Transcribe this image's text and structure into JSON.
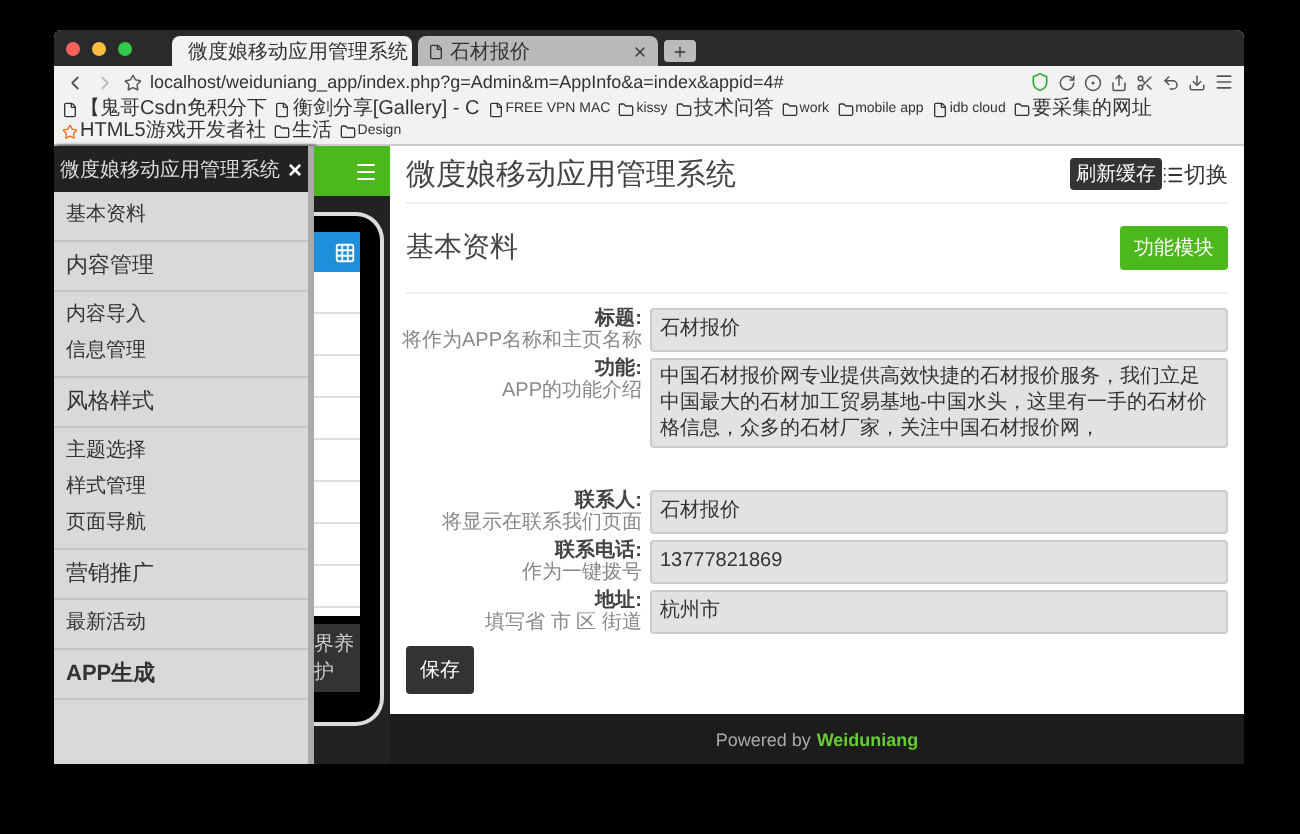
{
  "browser": {
    "tabs": [
      {
        "title": "微度娘移动应用管理系统",
        "selected": true
      },
      {
        "title": "石材报价",
        "selected": false
      }
    ],
    "address": "localhost/weiduniang_app/index.php?g=Admin&m=AppInfo&a=index&appid=4#",
    "bookmarks": [
      {
        "label": "【鬼哥Csdn免积分下",
        "kind": "page"
      },
      {
        "label": "衡剑分享[Gallery] - C",
        "kind": "page"
      },
      {
        "label": "FREE VPN MAC",
        "kind": "page"
      },
      {
        "label": "kissy",
        "kind": "folder"
      },
      {
        "label": "技术问答",
        "kind": "folder"
      },
      {
        "label": "work",
        "kind": "folder"
      },
      {
        "label": "mobile app",
        "kind": "folder"
      },
      {
        "label": "idb cloud",
        "kind": "page"
      },
      {
        "label": "要采集的网址",
        "kind": "folder"
      },
      {
        "label": "HTML5游戏开发者社",
        "kind": "star"
      },
      {
        "label": "生活",
        "kind": "folder"
      },
      {
        "label": "Design",
        "kind": "folder"
      }
    ]
  },
  "side_menu": {
    "title": "微度娘移动应用管理系统",
    "close": "×",
    "groups": [
      {
        "items": [
          {
            "label": "基本资料",
            "kind": "link"
          }
        ]
      },
      {
        "items": [
          {
            "label": "内容管理",
            "kind": "section"
          }
        ]
      },
      {
        "items": [
          {
            "label": "内容导入",
            "kind": "link"
          },
          {
            "label": "信息管理",
            "kind": "link"
          }
        ]
      },
      {
        "items": [
          {
            "label": "风格样式",
            "kind": "section"
          }
        ]
      },
      {
        "items": [
          {
            "label": "主题选择",
            "kind": "link"
          },
          {
            "label": "样式管理",
            "kind": "link"
          },
          {
            "label": "页面导航",
            "kind": "link"
          }
        ]
      },
      {
        "items": [
          {
            "label": "营销推广",
            "kind": "section"
          }
        ]
      },
      {
        "items": [
          {
            "label": "最新活动",
            "kind": "link"
          }
        ]
      },
      {
        "items": [
          {
            "label": "APP生成",
            "kind": "strong"
          }
        ]
      }
    ]
  },
  "preview": {
    "caption": "界养护"
  },
  "header": {
    "title": "微度娘移动应用管理系统",
    "refresh_button": "刷新缓存",
    "toggle": "切换"
  },
  "section": {
    "title": "基本资料",
    "module_button": "功能模块"
  },
  "form": {
    "rows": [
      {
        "label": "标题:",
        "hint": "将作为APP名称和主页名称",
        "value": "石材报价",
        "kind": "input"
      },
      {
        "label": "功能:",
        "hint": "APP的功能介绍",
        "value": "中国石材报价网专业提供高效快捷的石材报价服务，我们立足中国最大的石材加工贸易基地-中国水头，这里有一手的石材价格信息，众多的石材厂家，关注中国石材报价网，",
        "kind": "textarea"
      },
      {
        "label": "联系人:",
        "hint": "将显示在联系我们页面",
        "value": "石材报价",
        "kind": "input"
      },
      {
        "label": "联系电话:",
        "hint": "作为一键拨号",
        "value": "13777821869",
        "kind": "input"
      },
      {
        "label": "地址:",
        "hint": "填写省 市 区 街道",
        "value": "杭州市",
        "kind": "input"
      }
    ],
    "save_button": "保存"
  },
  "footer": {
    "prefix": "Powered by",
    "brand": "Weiduniang"
  }
}
